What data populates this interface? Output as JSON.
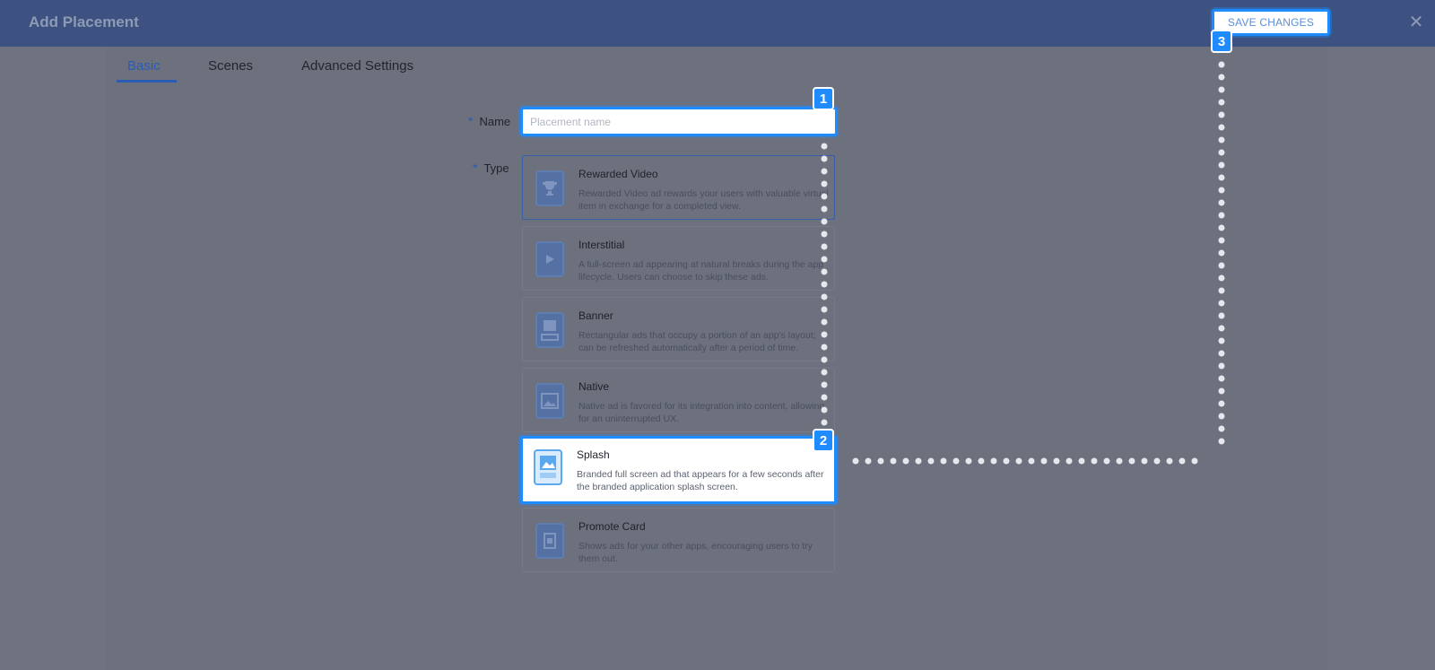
{
  "header": {
    "title": "Add Placement",
    "save_label": "SAVE CHANGES",
    "close_glyph": "✕"
  },
  "tabs": [
    {
      "label": "Basic",
      "active": true
    },
    {
      "label": "Scenes",
      "active": false
    },
    {
      "label": "Advanced Settings",
      "active": false
    }
  ],
  "form": {
    "name_label": "Name",
    "name_placeholder": "Placement name",
    "name_value": "",
    "type_label": "Type",
    "required_mark": "*"
  },
  "types": [
    {
      "title": "Rewarded Video",
      "desc": "Rewarded Video ad rewards your users with valuable virtual item in exchange for a completed view.",
      "icon": "trophy-icon",
      "state": "selected"
    },
    {
      "title": "Interstitial",
      "desc": "A full-screen ad appearing at natural breaks during the app lifecycle. Users can choose to skip these ads.",
      "icon": "play-icon",
      "state": "normal"
    },
    {
      "title": "Banner",
      "desc": "Rectangular ads that occupy a portion of an app's layout; can be refreshed automatically after a period of time.",
      "icon": "banner-icon",
      "state": "normal"
    },
    {
      "title": "Native",
      "desc": "Native ad is favored for its integration into content, allowing for an uninterrupted UX.",
      "icon": "image-icon",
      "state": "normal"
    },
    {
      "title": "Splash",
      "desc": "Branded full screen ad that appears for a few seconds after the branded application splash screen.",
      "icon": "splash-icon",
      "state": "highlighted"
    },
    {
      "title": "Promote Card",
      "desc": "Shows ads for your other apps, encouraging users to try them out.",
      "icon": "card-icon",
      "state": "normal"
    }
  ],
  "markers": [
    "1",
    "2",
    "3"
  ],
  "colors": {
    "header": "#3d5280",
    "overlay": "#6f727f",
    "accent": "#1e8cff",
    "primary": "#2a5cb3"
  }
}
